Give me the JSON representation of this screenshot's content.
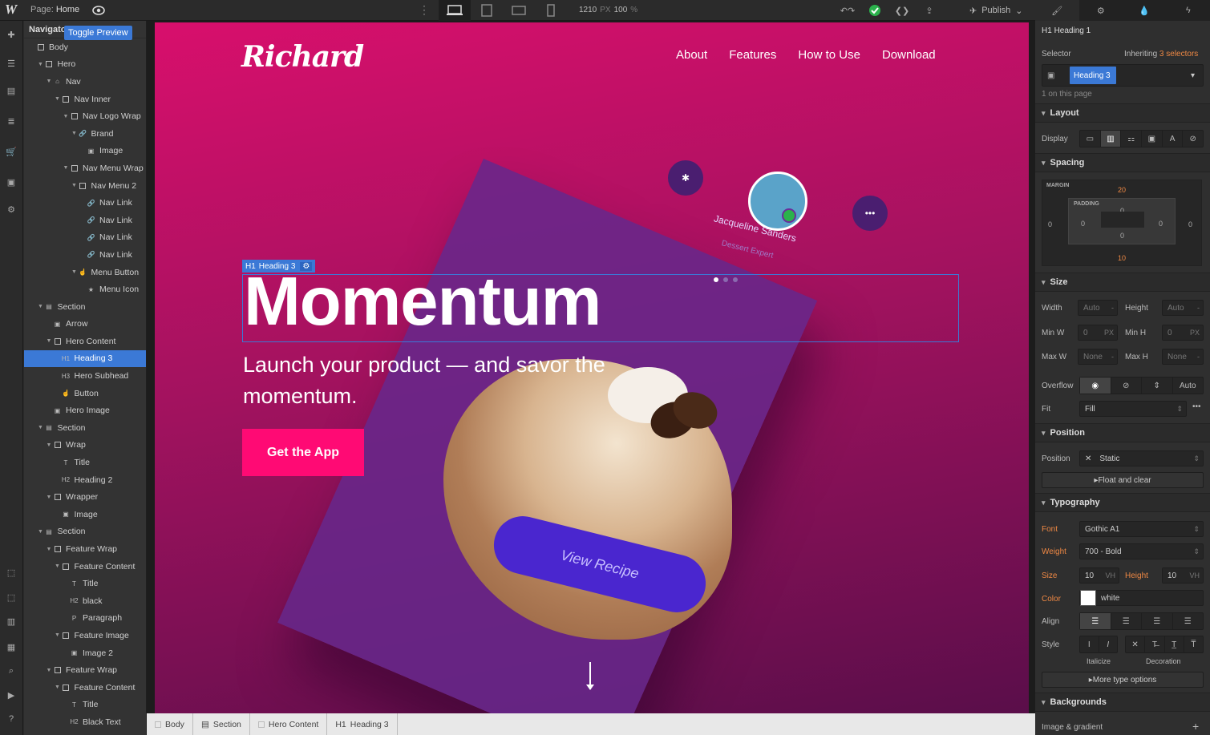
{
  "topbar": {
    "page_label": "Page:",
    "page_name": "Home",
    "width": "1210",
    "width_unit": "PX",
    "zoom": "100",
    "zoom_unit": "%",
    "publish": "Publish"
  },
  "tooltip": "Toggle Preview",
  "navigator": {
    "title": "Navigator",
    "items": [
      {
        "label": "Body",
        "depth": 0,
        "icon": "box"
      },
      {
        "label": "Hero",
        "depth": 1,
        "icon": "box",
        "caret": true
      },
      {
        "label": "Nav",
        "depth": 2,
        "icon": "home",
        "caret": true
      },
      {
        "label": "Nav Inner",
        "depth": 3,
        "icon": "box",
        "caret": true
      },
      {
        "label": "Nav Logo Wrap",
        "depth": 4,
        "icon": "box",
        "caret": true
      },
      {
        "label": "Brand",
        "depth": 5,
        "icon": "link",
        "caret": true
      },
      {
        "label": "Image",
        "depth": 6,
        "icon": "img"
      },
      {
        "label": "Nav Menu Wrap",
        "depth": 4,
        "icon": "box",
        "caret": true
      },
      {
        "label": "Nav Menu 2",
        "depth": 5,
        "icon": "box",
        "caret": true
      },
      {
        "label": "Nav Link",
        "depth": 6,
        "icon": "link"
      },
      {
        "label": "Nav Link",
        "depth": 6,
        "icon": "link"
      },
      {
        "label": "Nav Link",
        "depth": 6,
        "icon": "link"
      },
      {
        "label": "Nav Link",
        "depth": 6,
        "icon": "link"
      },
      {
        "label": "Menu Button",
        "depth": 5,
        "icon": "hand",
        "caret": true
      },
      {
        "label": "Menu Icon",
        "depth": 6,
        "icon": "star"
      },
      {
        "label": "Section",
        "depth": 1,
        "icon": "sec",
        "caret": true
      },
      {
        "label": "Arrow",
        "depth": 2,
        "icon": "img"
      },
      {
        "label": "Hero Content",
        "depth": 2,
        "icon": "box",
        "caret": true
      },
      {
        "label": "Heading 3",
        "depth": 3,
        "icon": "h1",
        "selected": true
      },
      {
        "label": "Hero Subhead",
        "depth": 3,
        "icon": "h3"
      },
      {
        "label": "Button",
        "depth": 3,
        "icon": "hand"
      },
      {
        "label": "Hero Image",
        "depth": 2,
        "icon": "img"
      },
      {
        "label": "Section",
        "depth": 1,
        "icon": "sec",
        "caret": true
      },
      {
        "label": "Wrap",
        "depth": 2,
        "icon": "box",
        "caret": true
      },
      {
        "label": "Title",
        "depth": 3,
        "icon": "t"
      },
      {
        "label": "Heading 2",
        "depth": 3,
        "icon": "h2"
      },
      {
        "label": "Wrapper",
        "depth": 2,
        "icon": "box",
        "caret": true
      },
      {
        "label": "Image",
        "depth": 3,
        "icon": "img"
      },
      {
        "label": "Section",
        "depth": 1,
        "icon": "sec",
        "caret": true
      },
      {
        "label": "Feature Wrap",
        "depth": 2,
        "icon": "box",
        "caret": true
      },
      {
        "label": "Feature Content",
        "depth": 3,
        "icon": "box",
        "caret": true
      },
      {
        "label": "Title",
        "depth": 4,
        "icon": "t"
      },
      {
        "label": "black",
        "depth": 4,
        "icon": "h2"
      },
      {
        "label": "Paragraph",
        "depth": 4,
        "icon": "p"
      },
      {
        "label": "Feature Image",
        "depth": 3,
        "icon": "box",
        "caret": true
      },
      {
        "label": "Image 2",
        "depth": 4,
        "icon": "img"
      },
      {
        "label": "Feature Wrap",
        "depth": 2,
        "icon": "box",
        "caret": true
      },
      {
        "label": "Feature Content",
        "depth": 3,
        "icon": "box",
        "caret": true
      },
      {
        "label": "Title",
        "depth": 4,
        "icon": "t"
      },
      {
        "label": "Black Text",
        "depth": 4,
        "icon": "h2"
      }
    ]
  },
  "site": {
    "brand": "Richard",
    "menu": [
      "About",
      "Features",
      "How to Use",
      "Download"
    ],
    "heading": "Momentum",
    "subhead": "Launch your product — and savor the momentum.",
    "cta": "Get the App",
    "phone_name": "Jacqueline Sanders",
    "phone_role": "Dessert Expert",
    "phone_button": "View Recipe",
    "selection_tag": "Heading 3",
    "selection_tag_prefix": "H1"
  },
  "breadcrumbs": [
    "Body",
    "Section",
    "Hero Content",
    "Heading 3"
  ],
  "panel": {
    "element": "Heading 1",
    "selector_label": "Selector",
    "inheriting": "Inheriting",
    "inheriting_count": "3 selectors",
    "selector_chip": "Heading 3",
    "on_page": "1 on this page",
    "layout": "Layout",
    "display": "Display",
    "spacing": "Spacing",
    "margin": "MARGIN",
    "padding": "PADDING",
    "margin_top": "20",
    "margin_bottom": "10",
    "margin_left": "0",
    "margin_right": "0",
    "padding_top": "0",
    "padding_bottom": "0",
    "padding_left": "0",
    "padding_right": "0",
    "size": "Size",
    "width": "Width",
    "height": "Height",
    "minw": "Min W",
    "minh": "Min H",
    "maxw": "Max W",
    "maxh": "Max H",
    "auto": "Auto",
    "zero": "0",
    "none": "None",
    "px": "PX",
    "dash": "-",
    "overflow": "Overflow",
    "overflow_auto": "Auto",
    "fit": "Fit",
    "fit_value": "Fill",
    "position": "Position",
    "position_value": "Static",
    "float_clear": "Float and clear",
    "typography": "Typography",
    "font": "Font",
    "font_value": "Gothic A1",
    "weight": "Weight",
    "weight_value": "700 - Bold",
    "size_lbl": "Size",
    "size_value": "10",
    "height_lbl": "Height",
    "height_value": "10",
    "vh": "VH",
    "color": "Color",
    "color_value": "white",
    "align": "Align",
    "style": "Style",
    "italicize": "Italicize",
    "decoration": "Decoration",
    "more_type": "More type options",
    "backgrounds": "Backgrounds",
    "image_gradient": "Image & gradient"
  }
}
